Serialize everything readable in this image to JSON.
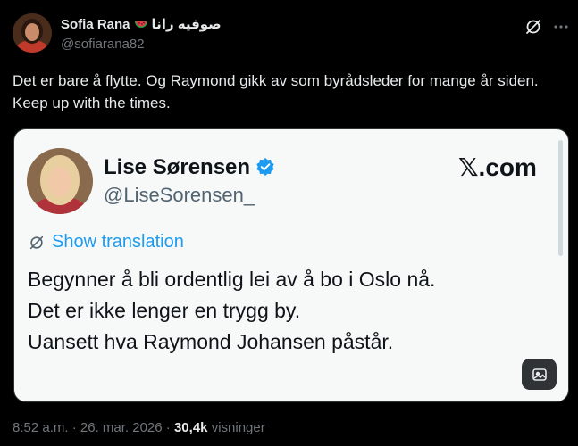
{
  "author": {
    "name": "Sofia Rana",
    "emoji_icon": "watermelon-icon",
    "name_arabic": "صوفيه رانا",
    "handle": "@sofiarana82"
  },
  "post": {
    "text": "Det er bare å flytte. Og Raymond gikk av som byrådsleder for mange år siden. Keep up with the times."
  },
  "embedded_card": {
    "name": "Lise Sørensen",
    "verified_icon": "verified-badge-icon",
    "handle": "@LiseSorensen_",
    "logo_text": "𝕏.com",
    "translate_label": "Show translation",
    "lines": [
      "Begynner å bli ordentlig lei av å bo i Oslo nå.",
      "Det er ikke lenger en trygg by.",
      "Uansett hva Raymond Johansen påstår."
    ]
  },
  "meta": {
    "time": "8:52 a.m.",
    "sep1": "·",
    "date": "26. mar. 2026",
    "sep2": "·",
    "views": "30,4k",
    "views_label": "visninger"
  },
  "colors": {
    "background": "#000000",
    "text": "#e7e9ea",
    "secondary": "#71767b",
    "accent": "#1d9bf0",
    "card_background": "#f7f9f9"
  }
}
